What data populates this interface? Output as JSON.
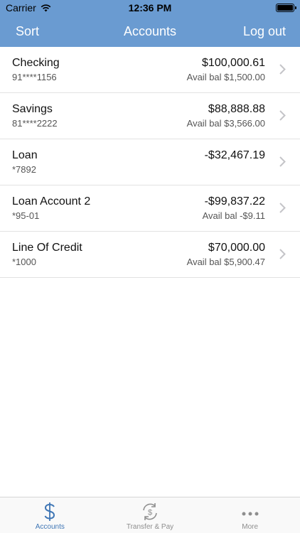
{
  "status_bar": {
    "carrier": "Carrier",
    "time": "12:36 PM"
  },
  "nav": {
    "left": "Sort",
    "title": "Accounts",
    "right": "Log out"
  },
  "accounts": [
    {
      "name": "Checking",
      "number": "91****1156",
      "balance": "$100,000.61",
      "avail": "Avail bal $1,500.00"
    },
    {
      "name": "Savings",
      "number": "81****2222",
      "balance": "$88,888.88",
      "avail": "Avail bal $3,566.00"
    },
    {
      "name": "Loan",
      "number": "*7892",
      "balance": "-$32,467.19",
      "avail": ""
    },
    {
      "name": "Loan Account 2",
      "number": "*95-01",
      "balance": "-$99,837.22",
      "avail": "Avail bal -$9.11"
    },
    {
      "name": "Line Of Credit",
      "number": "*1000",
      "balance": "$70,000.00",
      "avail": "Avail bal $5,900.47"
    }
  ],
  "tabs": [
    {
      "label": "Accounts",
      "icon": "dollar-icon"
    },
    {
      "label": "Transfer & Pay",
      "icon": "transfer-icon"
    },
    {
      "label": "More",
      "icon": "more-icon"
    }
  ],
  "colors": {
    "header": "#6a9bd1",
    "accent": "#3f76b5"
  }
}
